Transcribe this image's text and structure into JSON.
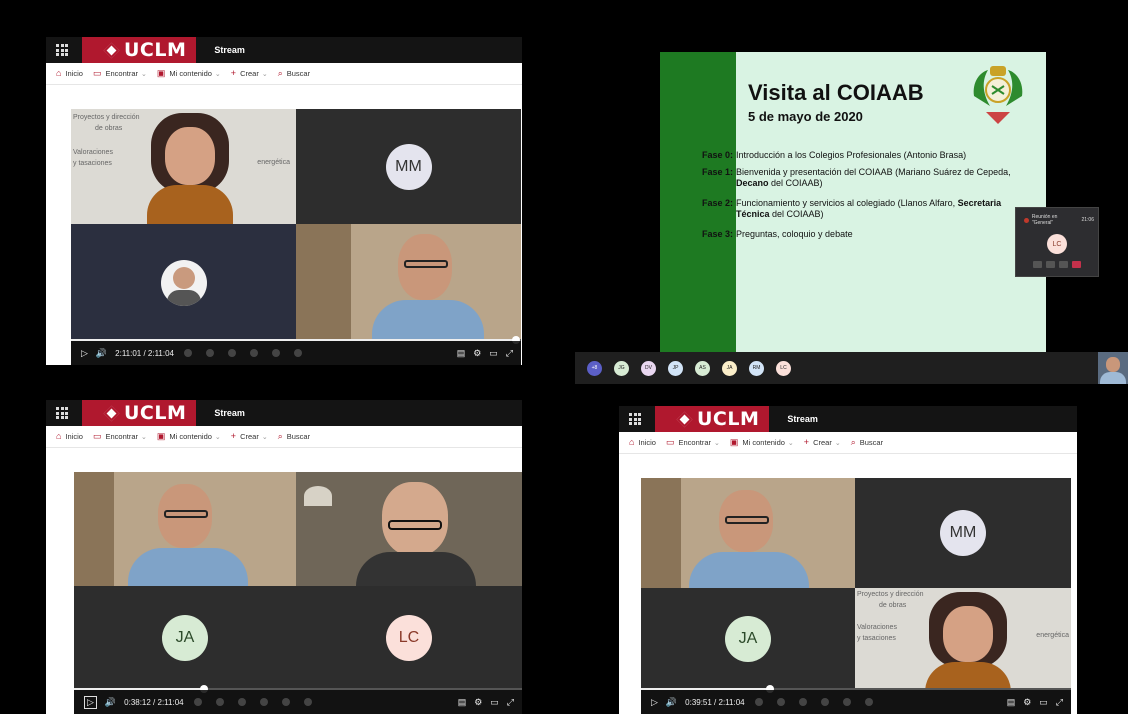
{
  "stream_ui": {
    "logo": "UCLM",
    "app_name": "Stream",
    "nav": {
      "home": "Inicio",
      "discover": "Encontrar",
      "my_content": "Mi contenido",
      "create": "Crear",
      "search": "Buscar"
    }
  },
  "players": [
    {
      "time": "2:11:01 / 2:11:04",
      "progress": 0.99
    },
    {
      "time": "0:38:12 / 2:11:04",
      "progress": 0.29
    },
    {
      "time": "0:39:51 / 2:11:04",
      "progress": 0.3
    }
  ],
  "avatars": {
    "mm": "MM",
    "ja": "JA",
    "lc": "LC"
  },
  "slide": {
    "title": "Visita al COIAAB",
    "subtitle": "5 de mayo de 2020",
    "phases": [
      {
        "label": "Fase 0:",
        "text": "Introducción a los Colegios Profesionales (Antonio Brasa)"
      },
      {
        "label": "Fase 1:",
        "text_a": "Bienvenida y presentación del COIAAB (Mariano Suárez de Cepeda, ",
        "bold": "Decano",
        "text_b": " del COIAAB)"
      },
      {
        "label": "Fase 2:",
        "text_a": "Funcionamiento y servicios al colegiado (Llanos Alfaro, ",
        "bold": "Secretaria Técnica",
        "text_b": " del COIAAB)"
      },
      {
        "label": "Fase 3:",
        "text": "Preguntas, coloquio y debate"
      }
    ]
  },
  "teams": {
    "meeting_title": "Reunión en \"General\"",
    "meeting_time": "21:06",
    "self_initials": "LC",
    "strip": [
      {
        "initials": "+8",
        "color": "#5b5fc7"
      },
      {
        "initials": "JG",
        "color": "#d7ebd4"
      },
      {
        "initials": "DV",
        "color": "#e9d7f0"
      },
      {
        "initials": "JP",
        "color": "#d2e4f7"
      },
      {
        "initials": "AS",
        "color": "#d7ebd4"
      },
      {
        "initials": "JA",
        "color": "#fbeec9"
      },
      {
        "initials": "RM",
        "color": "#d2e4f7"
      },
      {
        "initials": "LC",
        "color": "#fbe0da"
      }
    ]
  },
  "backdrop_text": {
    "line1": "Proyectos y dirección",
    "line2": "de obras",
    "line3": "Valoraciones",
    "line4": "y tasaciones",
    "energy": "energética"
  }
}
